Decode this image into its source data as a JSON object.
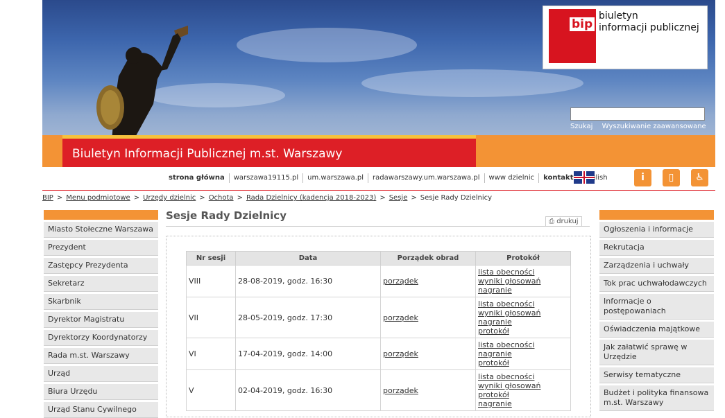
{
  "header": {
    "logo_mark": "bip",
    "logo_line1": "biuletyn",
    "logo_line2": "informacji publicznej",
    "search_placeholder": "",
    "search_button": "Szukaj",
    "advanced_search": "Wyszukiwanie zaawansowane",
    "site_title": "Biuletyn Informacji Publicznej m.st. Warszawy"
  },
  "nav": {
    "links": [
      "strona główna",
      "warszawa19115.pl",
      "um.warszawa.pl",
      "radawarszawy.um.warszawa.pl",
      "www dzielnic",
      "kontakt",
      "English"
    ],
    "icons": [
      "info-rss-icon",
      "mobile-icon",
      "accessibility-icon"
    ]
  },
  "breadcrumb": [
    "BIP",
    "Menu podmiotowe",
    "Urzędy dzielnic",
    "Ochota",
    "Rada Dzielnicy (kadencja 2018-2023)",
    "Sesje",
    "Sesje Rady Dzielnicy"
  ],
  "left_nav": [
    "Miasto Stołeczne Warszawa",
    "Prezydent",
    "Zastępcy Prezydenta",
    "Sekretarz",
    "Skarbnik",
    "Dyrektor Magistratu",
    "Dyrektorzy Koordynatorzy",
    "Rada m.st. Warszawy",
    "Urząd",
    "Biura Urzędu",
    "Urząd Stanu Cywilnego"
  ],
  "right_nav": [
    "Ogłoszenia i informacje",
    "Rekrutacja",
    "Zarządzenia i uchwały",
    "Tok prac uchwałodawczych",
    "Informacje o postępowaniach",
    "Oświadczenia majątkowe",
    "Jak załatwić sprawę w Urzędzie",
    "Serwisy tematyczne",
    "Budżet i polityka finansowa m.st. Warszawy"
  ],
  "main": {
    "title": "Sesje Rady Dzielnicy",
    "print_label": "drukuj",
    "table": {
      "headers": [
        "Nr sesji",
        "Data",
        "Porządek obrad",
        "Protokół"
      ],
      "rows": [
        {
          "nr": "VIII",
          "data": "28-08-2019, godz. 16:30",
          "porzadek": "porządek",
          "links": [
            "lista obecności",
            "wyniki głosowań",
            "nagranie"
          ]
        },
        {
          "nr": "VII",
          "data": "28-05-2019, godz. 17:30",
          "porzadek": "porządek",
          "links": [
            "lista obecności",
            "wyniki głosowań",
            "nagranie",
            "protokół"
          ]
        },
        {
          "nr": "VI",
          "data": "17-04-2019, godz. 14:00",
          "porzadek": "porządek",
          "links": [
            "lista obecności",
            "nagranie",
            "protokół"
          ]
        },
        {
          "nr": "V",
          "data": "02-04-2019, godz. 16:30",
          "porzadek": "porządek",
          "links": [
            "lista obecności",
            "wyniki głosowań",
            "protokół",
            "nagranie"
          ]
        }
      ]
    }
  }
}
